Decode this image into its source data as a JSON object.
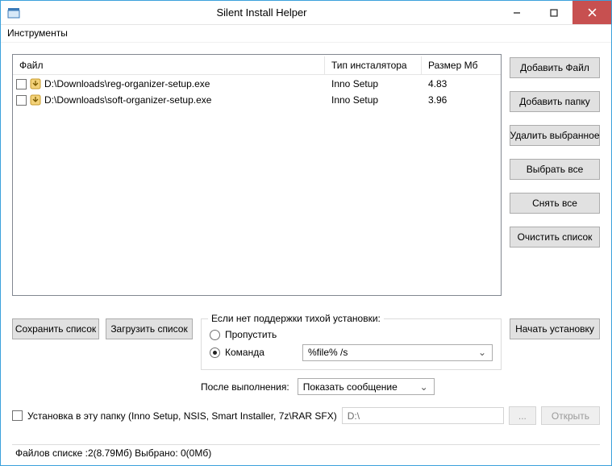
{
  "window": {
    "title": "Silent Install Helper"
  },
  "menu": {
    "tools": "Инструменты"
  },
  "list": {
    "headers": {
      "file": "Файл",
      "type": "Тип инсталятора",
      "size": "Размер Мб"
    },
    "rows": [
      {
        "path": "D:\\Downloads\\reg-organizer-setup.exe",
        "type": "Inno Setup",
        "size": "4.83"
      },
      {
        "path": "D:\\Downloads\\soft-organizer-setup.exe",
        "type": "Inno Setup",
        "size": "3.96"
      }
    ]
  },
  "sidebar": {
    "add_file": "Добавить Файл",
    "add_folder": "Добавить папку",
    "delete_selected": "Удалить выбранное",
    "select_all": "Выбрать все",
    "deselect_all": "Снять все",
    "clear_list": "Очистить список"
  },
  "actions": {
    "save_list": "Сохранить список",
    "load_list": "Загрузить список",
    "start_install": "Начать установку"
  },
  "group": {
    "title": "Если нет поддержки тихой установки:",
    "skip": "Пропустить",
    "command": "Команда",
    "command_value": "%file% /s"
  },
  "after": {
    "label": "После выполнения:",
    "value": "Показать сообщение"
  },
  "install_to": {
    "label": "Установка в эту папку (Inno Setup, NSIS, Smart Installer, 7z\\RAR SFX)",
    "path": "D:\\",
    "browse": "...",
    "open": "Открыть"
  },
  "status": "Файлов списке :2(8.79Мб) Выбрано: 0(0Мб)"
}
